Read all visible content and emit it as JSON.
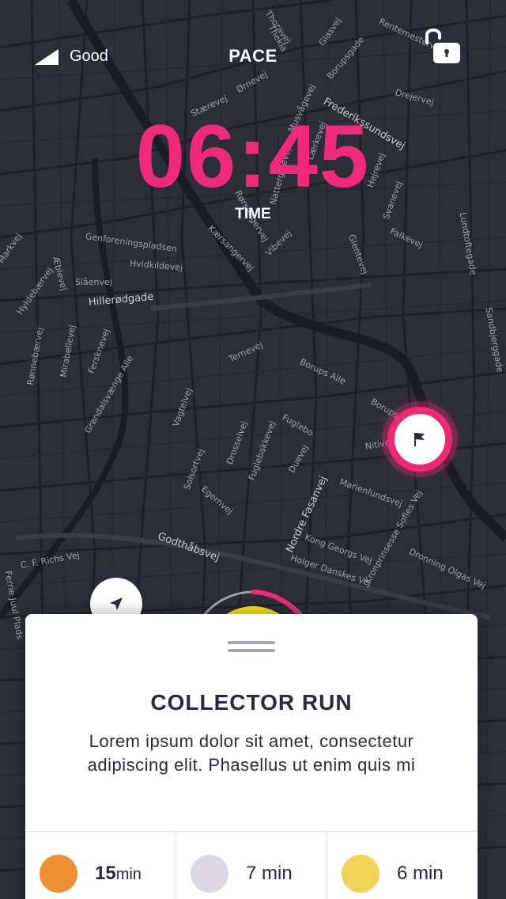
{
  "status": {
    "signal_label": "Good"
  },
  "header": {
    "title": "PACE"
  },
  "timer": {
    "value": "06:45",
    "label": "TIME"
  },
  "map": {
    "streets": [
      "Thoravej",
      "Thekla",
      "Rentemestervej",
      "Glasvej",
      "Borupsgade",
      "Ørnevej",
      "Stærevej",
      "Musvågevej",
      "Frederikssundsvej",
      "Drejervej",
      "Lærkevej",
      "Rørsangervej",
      "Nattergalevej",
      "Vibevej",
      "Hejrevej",
      "Svanevej",
      "Lundtoftegade",
      "Genforeningspladsen",
      "Hvidkildevej",
      "Kærsangervej",
      "Falkevej",
      "Glentevej",
      "Markvej",
      "Æblevej",
      "Slåenvej",
      "Hyldebærvej",
      "Hillerødgade",
      "Ternevej",
      "Borups Alle",
      "Rønnebærvej",
      "Mirabellevej",
      "Fersknevej",
      "Grøndalsvænge Alle",
      "Vagtelvej",
      "Solsortvej",
      "Drosselvej",
      "Fuglebakkevej",
      "Duevej",
      "Fuglebo",
      "Marienlundsvej",
      "Nordre Fasanvej",
      "Kong Georgs Vej",
      "Holger Danskes Vej",
      "Kronprinsesse Sofies Vej",
      "Dronning Olgas Vej",
      "Godthåbsvej",
      "C. F. Richs Vej",
      "Egernvej",
      "Sandbjerggade",
      "Nitivej",
      "Borups Plads",
      "Ferrie Juul Plads"
    ]
  },
  "card": {
    "title": "COLLECTOR RUN",
    "description": "Lorem ipsum dolor sit amet, consectetur adipiscing elit. Phasellus ut enim quis mi",
    "stats": [
      {
        "value": "15",
        "unit": "min",
        "color": "#ef8f33"
      },
      {
        "value": "7 min",
        "unit": "",
        "color": "#dcd8e2"
      },
      {
        "value": "6 min",
        "unit": "",
        "color": "#f1d457"
      }
    ]
  },
  "colors": {
    "accent": "#f0297a",
    "map_bg": "#2c2f3a",
    "progress_yellow": "#f5e21a"
  }
}
